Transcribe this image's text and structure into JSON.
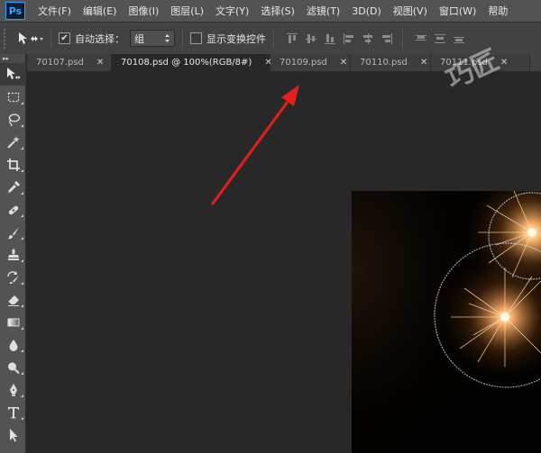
{
  "app": {
    "logo_text": "Ps",
    "menu": [
      "文件(F)",
      "编辑(E)",
      "图像(I)",
      "图层(L)",
      "文字(Y)",
      "选择(S)",
      "滤镜(T)",
      "3D(D)",
      "视图(V)",
      "窗口(W)",
      "帮助"
    ]
  },
  "options": {
    "auto_select_label": "自动选择：",
    "auto_select_value": "组",
    "show_transform_label": "显示变换控件",
    "auto_select_checked": true,
    "show_transform_checked": false
  },
  "tabs": [
    {
      "label": "70107.psd",
      "active": false
    },
    {
      "label": "70108.psd @ 100%(RGB/8#)",
      "active": true
    },
    {
      "label": "70109.psd",
      "active": false
    },
    {
      "label": "70110.psd",
      "active": false
    },
    {
      "label": "70111.psd",
      "active": false
    }
  ],
  "tools": [
    "move-tool",
    "marquee-tool",
    "lasso-tool",
    "magic-wand-tool",
    "crop-tool",
    "eyedropper-tool",
    "healing-brush-tool",
    "brush-tool",
    "clone-stamp-tool",
    "history-brush-tool",
    "eraser-tool",
    "gradient-tool",
    "blur-tool",
    "dodge-tool",
    "pen-tool",
    "type-tool",
    "path-selection-tool"
  ],
  "colors": {
    "menubar": "#535353",
    "options_bar": "#424242",
    "workspace": "#282828",
    "arrow": "#e51d1d",
    "logo_border": "#2fa3f7"
  },
  "watermark_text": "巧匠"
}
